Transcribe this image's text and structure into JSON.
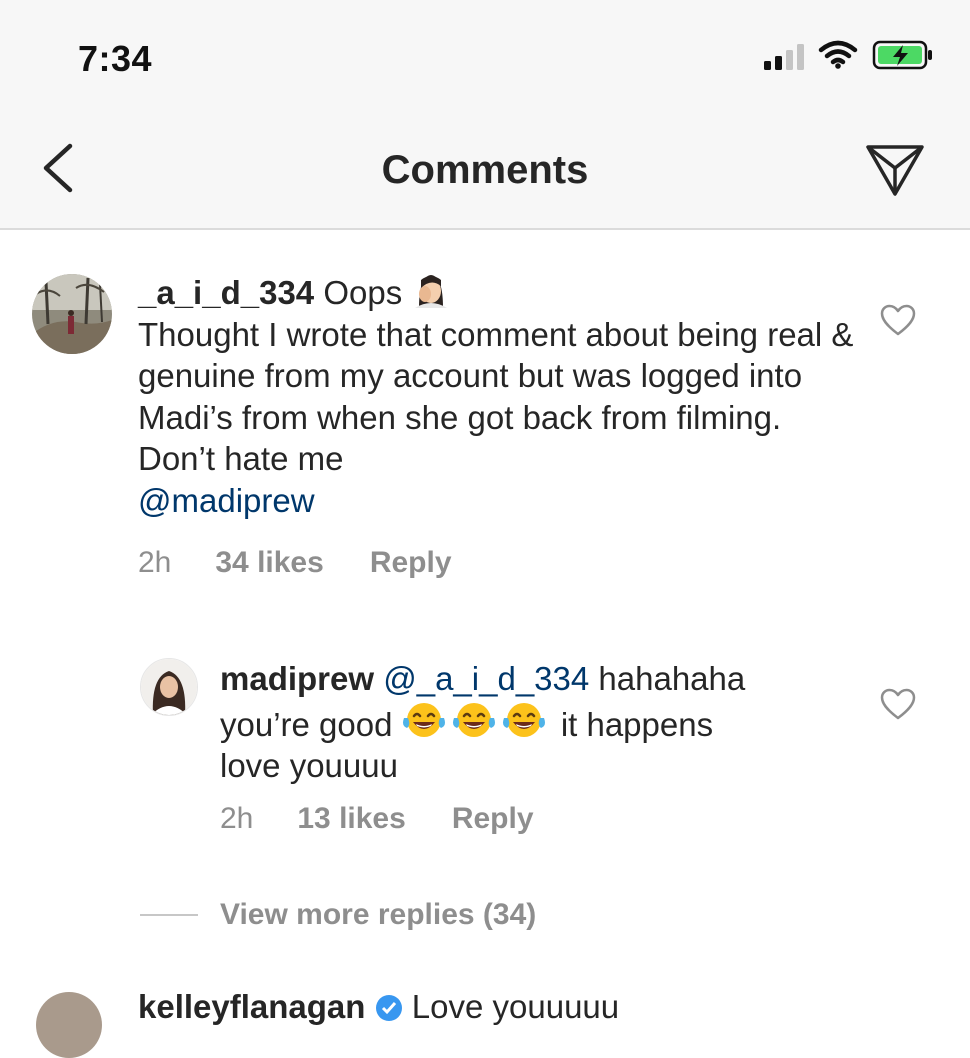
{
  "status_bar": {
    "time": "7:34"
  },
  "header": {
    "title": "Comments"
  },
  "comments": [
    {
      "username": "_a_i_d_334",
      "text_lead": "Oops",
      "text_body": "Thought I wrote that comment about being real & genuine from my account but was logged into Madi’s from when she got back from filming. Don’t hate me",
      "mention": "@madiprew",
      "age": "2h",
      "likes": "34 likes",
      "reply_label": "Reply"
    }
  ],
  "replies": [
    {
      "username": "madiprew",
      "mention": "@_a_i_d_334",
      "text_lead": "hahahaha",
      "text_mid": "you’re good",
      "text_after_emoji": "it happens",
      "text_end": "love youuuu",
      "age": "2h",
      "likes": "13 likes",
      "reply_label": "Reply"
    }
  ],
  "view_more_label": "View more replies (34)",
  "next_comment": {
    "username": "kelleyflanagan",
    "text": "Love youuuuu"
  },
  "colors": {
    "mention": "#00376b",
    "meta": "#8e8e8e",
    "header_bg": "#f7f7f7",
    "battery": "#4cd964"
  }
}
